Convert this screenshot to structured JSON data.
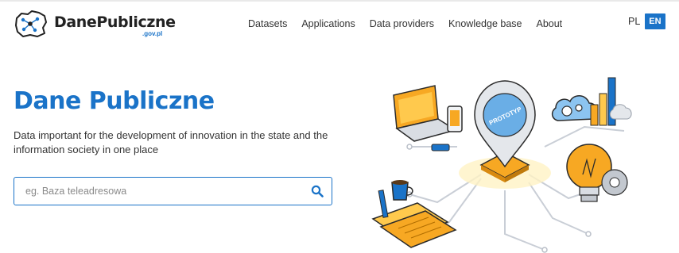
{
  "brand": {
    "name": "DanePubliczne",
    "domain": ".gov.pl",
    "color": "#1a73c8"
  },
  "nav": {
    "items": [
      "Datasets",
      "Applications",
      "Data providers",
      "Knowledge base",
      "About"
    ]
  },
  "language": {
    "options": [
      "PL",
      "EN"
    ],
    "selected": "EN"
  },
  "hero": {
    "title": "Dane Publiczne",
    "subtitle": "Data important for the development of innovation in the state and the information society in one place"
  },
  "search": {
    "placeholder": "eg. Baza teleadresowa",
    "value": "",
    "icon": "search-icon"
  },
  "illustration": {
    "pin_label": "PROTOTYP",
    "icons": [
      "laptop-icon",
      "phone-icon",
      "location-pin-icon",
      "cloud-gears-icon",
      "bar-chart-icon",
      "lightbulb-icon",
      "coffee-cup-icon",
      "documents-icon"
    ]
  }
}
